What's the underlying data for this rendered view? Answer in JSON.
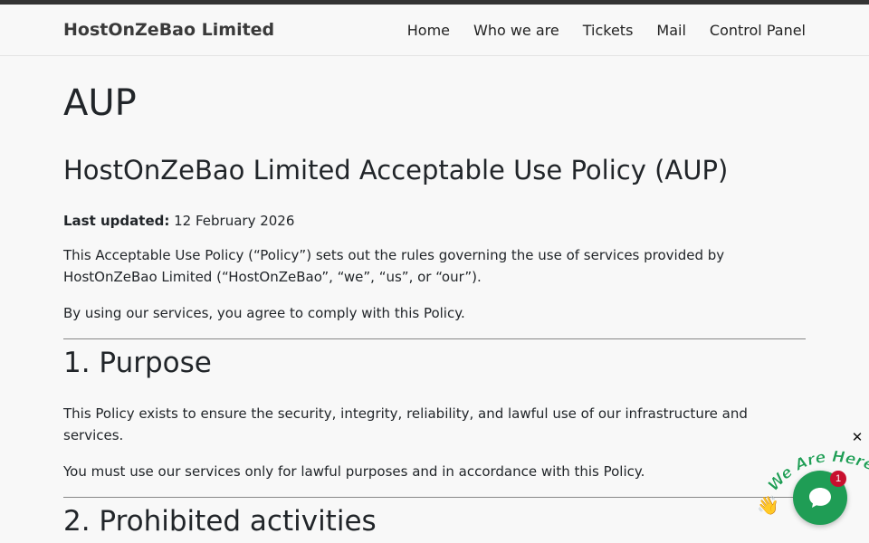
{
  "nav": {
    "brand": "HostOnZeBao Limited",
    "links": [
      "Home",
      "Who we are",
      "Tickets",
      "Mail",
      "Control Panel"
    ]
  },
  "page": {
    "title": "AUP",
    "policy_title": "HostOnZeBao Limited Acceptable Use Policy (AUP)",
    "updated_label": "Last updated:",
    "updated_value": " 12 February 2026",
    "intro": "This Acceptable Use Policy (“Policy”) sets out the rules governing the use of services provided by HostOnZeBao Limited (“HostOnZeBao”, “we”, “us”, or “our”).",
    "agree": "By using our services, you agree to comply with this Policy.",
    "sections": [
      {
        "heading": "1. Purpose",
        "paragraphs": [
          "This Policy exists to ensure the security, integrity, reliability, and lawful use of our infrastructure and services.",
          "You must use our services only for lawful purposes and in accordance with this Policy."
        ]
      },
      {
        "heading": "2. Prohibited activities",
        "paragraphs": []
      }
    ]
  },
  "chat": {
    "tag_text": "We Are Here!",
    "badge_count": "1",
    "close_symbol": "✕",
    "accent": "#1f9d55",
    "badge_color": "#c8102e",
    "wave_emoji": "👋"
  }
}
